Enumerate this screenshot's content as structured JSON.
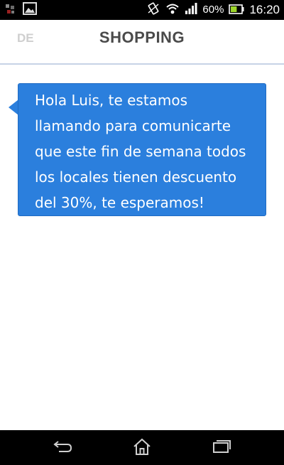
{
  "status_bar": {
    "notification_icons": [
      "app-notification-icon",
      "image-icon"
    ],
    "status_icons": [
      "vibrate-icon",
      "wifi-icon",
      "signal-icon"
    ],
    "battery_percent": "60%",
    "battery_level": 0.6,
    "time": "16:20"
  },
  "header": {
    "logo_text": "DE",
    "title": "SHOPPING"
  },
  "message": {
    "text": "Hola Luis, te estamos\nllamando para comunicarte\nque este fin de semana todos\nlos locales tienen descuento\ndel 30%, te esperamos!"
  },
  "nav_bar": {
    "buttons": [
      "back-icon",
      "home-icon",
      "recent-apps-icon"
    ]
  },
  "colors": {
    "bubble": "#2b7fdd",
    "title": "#4a4a4a",
    "divider": "#c7d3e6"
  }
}
